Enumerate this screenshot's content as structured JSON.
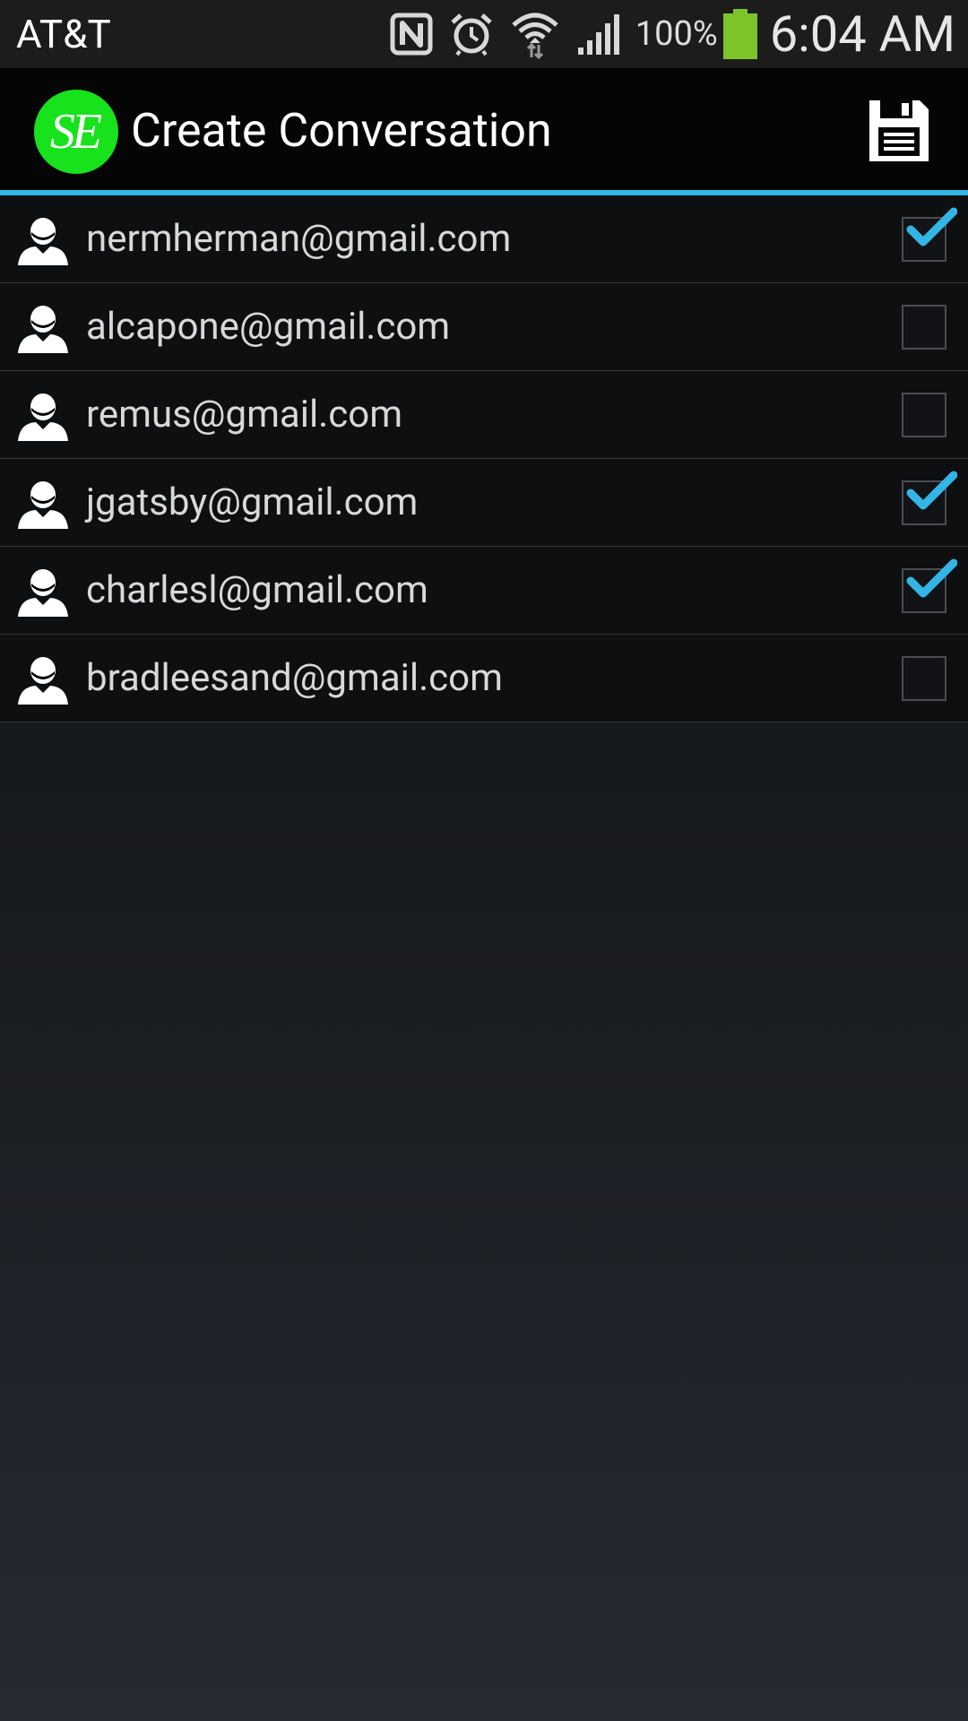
{
  "status_bar": {
    "carrier": "AT&T",
    "battery_percent": "100%",
    "time": "6:04 AM",
    "icons": [
      "nfc-icon",
      "alarm-icon",
      "wifi-icon",
      "signal-icon",
      "battery-icon"
    ]
  },
  "action_bar": {
    "logo_text": "SE",
    "title": "Create Conversation",
    "save_icon": "save-icon"
  },
  "contacts": [
    {
      "email": "nermherman@gmail.com",
      "checked": true
    },
    {
      "email": "alcapone@gmail.com",
      "checked": false
    },
    {
      "email": "remus@gmail.com",
      "checked": false
    },
    {
      "email": "jgatsby@gmail.com",
      "checked": true
    },
    {
      "email": "charlesl@gmail.com",
      "checked": true
    },
    {
      "email": "bradleesand@gmail.com",
      "checked": false
    }
  ],
  "colors": {
    "accent": "#33b5e5",
    "logo_green": "#17e21b",
    "battery_green": "#7cc42a"
  }
}
